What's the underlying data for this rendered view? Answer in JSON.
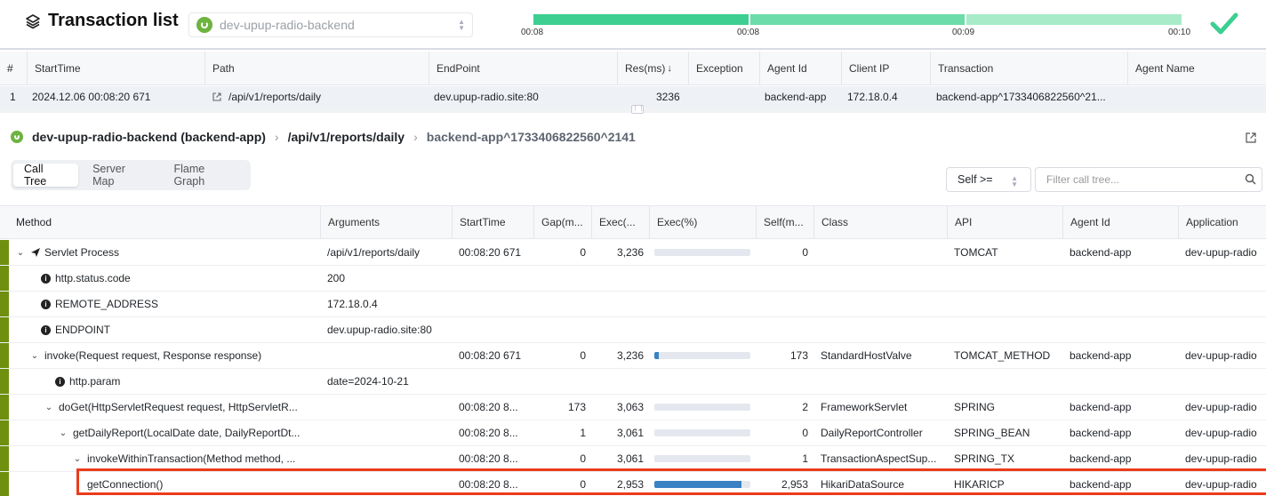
{
  "header": {
    "title": "Transaction list",
    "app_select": "dev-upup-radio-backend",
    "timeline_labels": [
      "00:08",
      "00:08",
      "00:09",
      "00:10"
    ],
    "timeline_colors": [
      "#3ccf91",
      "#6bdcaa",
      "#a8ebc9"
    ]
  },
  "list_table": {
    "columns": [
      "#",
      "StartTime",
      "Path",
      "EndPoint",
      "Res(ms)",
      "Exception",
      "Agent Id",
      "Client IP",
      "Transaction",
      "Agent Name"
    ],
    "sort_icon": "arrow-down-icon",
    "row": {
      "num": "1",
      "start_time": "2024.12.06 00:08:20 671",
      "path": "/api/v1/reports/daily",
      "endpoint": "dev.upup-radio.site:80",
      "res": "3236",
      "exception": "",
      "agent_id": "backend-app",
      "client_ip": "172.18.0.4",
      "transaction": "backend-app^1733406822560^21...",
      "agent_name": ""
    }
  },
  "breadcrumb": {
    "app": "dev-upup-radio-backend (backend-app)",
    "path": "/api/v1/reports/daily",
    "transaction": "backend-app^1733406822560^2141"
  },
  "tabs": [
    "Call Tree",
    "Server Map",
    "Flame Graph"
  ],
  "self_filter": "Self >=",
  "filter_placeholder": "Filter call tree...",
  "call_tree": {
    "columns": [
      "Method",
      "Arguments",
      "StartTime",
      "Gap(m...",
      "Exec(...",
      "Exec(%)",
      "Self(m...",
      "Class",
      "API",
      "Agent Id",
      "Application"
    ],
    "rows": [
      {
        "indent": 0,
        "icon": "chevron-down",
        "sub_icon": "send",
        "method": "Servlet Process",
        "args": "/api/v1/reports/daily",
        "start": "00:08:20 671",
        "gap": "0",
        "exec": "3,236",
        "pct": 0,
        "self": "0",
        "cls": "",
        "api": "TOMCAT",
        "agent": "backend-app",
        "app": "dev-upup-radio"
      },
      {
        "indent": 1,
        "icon": "info",
        "method": "http.status.code",
        "args": "200",
        "start": "",
        "gap": "",
        "exec": "",
        "pct": null,
        "self": "",
        "cls": "",
        "api": "",
        "agent": "",
        "app": ""
      },
      {
        "indent": 1,
        "icon": "info",
        "method": "REMOTE_ADDRESS",
        "args": "172.18.0.4",
        "start": "",
        "gap": "",
        "exec": "",
        "pct": null,
        "self": "",
        "cls": "",
        "api": "",
        "agent": "",
        "app": ""
      },
      {
        "indent": 1,
        "icon": "info",
        "method": "ENDPOINT",
        "args": "dev.upup-radio.site:80",
        "start": "",
        "gap": "",
        "exec": "",
        "pct": null,
        "self": "",
        "cls": "",
        "api": "",
        "agent": "",
        "app": ""
      },
      {
        "indent": 1,
        "icon": "chevron-down",
        "method": "invoke(Request request, Response response)",
        "args": "",
        "start": "00:08:20 671",
        "gap": "0",
        "exec": "3,236",
        "pct": 5,
        "self": "173",
        "cls": "StandardHostValve",
        "api": "TOMCAT_METHOD",
        "agent": "backend-app",
        "app": "dev-upup-radio"
      },
      {
        "indent": 2,
        "icon": "info",
        "method": "http.param",
        "args": "date=2024-10-21",
        "start": "",
        "gap": "",
        "exec": "",
        "pct": null,
        "self": "",
        "cls": "",
        "api": "",
        "agent": "",
        "app": ""
      },
      {
        "indent": 2,
        "icon": "chevron-down",
        "method": "doGet(HttpServletRequest request, HttpServletR...",
        "args": "",
        "start": "00:08:20 8...",
        "gap": "173",
        "exec": "3,063",
        "pct": 0,
        "self": "2",
        "cls": "FrameworkServlet",
        "api": "SPRING",
        "agent": "backend-app",
        "app": "dev-upup-radio"
      },
      {
        "indent": 3,
        "icon": "chevron-down",
        "method": "getDailyReport(LocalDate date, DailyReportDt...",
        "args": "",
        "start": "00:08:20 8...",
        "gap": "1",
        "exec": "3,061",
        "pct": 0,
        "self": "0",
        "cls": "DailyReportController",
        "api": "SPRING_BEAN",
        "agent": "backend-app",
        "app": "dev-upup-radio"
      },
      {
        "indent": 4,
        "icon": "chevron-down",
        "method": "invokeWithinTransaction(Method method, ...",
        "args": "",
        "start": "00:08:20 8...",
        "gap": "0",
        "exec": "3,061",
        "pct": 0,
        "self": "1",
        "cls": "TransactionAspectSup...",
        "api": "SPRING_TX",
        "agent": "backend-app",
        "app": "dev-upup-radio"
      },
      {
        "indent": 5,
        "icon": "none",
        "method": "getConnection()",
        "args": "",
        "start": "00:08:20 8...",
        "gap": "0",
        "exec": "2,953",
        "pct": 91,
        "self": "2,953",
        "cls": "HikariDataSource",
        "api": "HIKARICP",
        "agent": "backend-app",
        "app": "dev-upup-radio"
      }
    ]
  }
}
